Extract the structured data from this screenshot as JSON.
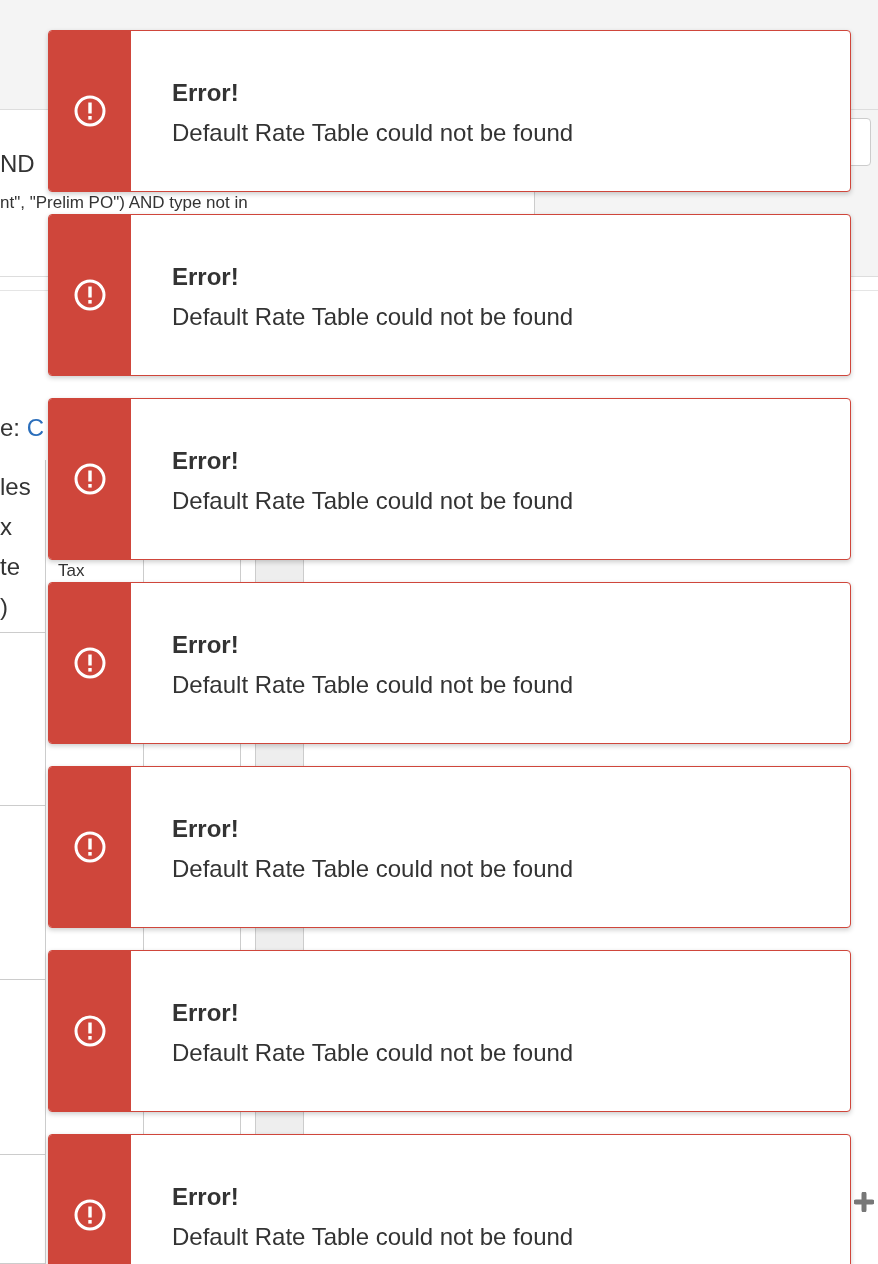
{
  "background": {
    "query_lines": [
      "ND",
      "nt\", \"Prelim PO\") AND type not in"
    ],
    "type_label": "e:",
    "type_link": "C",
    "header_cells": [
      "les x te )",
      "Tax"
    ]
  },
  "toasts": [
    {
      "kind": "error",
      "title": "Error!",
      "message": "Default Rate Table could not be found"
    },
    {
      "kind": "error",
      "title": "Error!",
      "message": "Default Rate Table could not be found"
    },
    {
      "kind": "error",
      "title": "Error!",
      "message": "Default Rate Table could not be found"
    },
    {
      "kind": "error",
      "title": "Error!",
      "message": "Default Rate Table could not be found"
    },
    {
      "kind": "error",
      "title": "Error!",
      "message": "Default Rate Table could not be found"
    },
    {
      "kind": "error",
      "title": "Error!",
      "message": "Default Rate Table could not be found"
    },
    {
      "kind": "error",
      "title": "Error!",
      "message": "Default Rate Table could not be found"
    }
  ]
}
